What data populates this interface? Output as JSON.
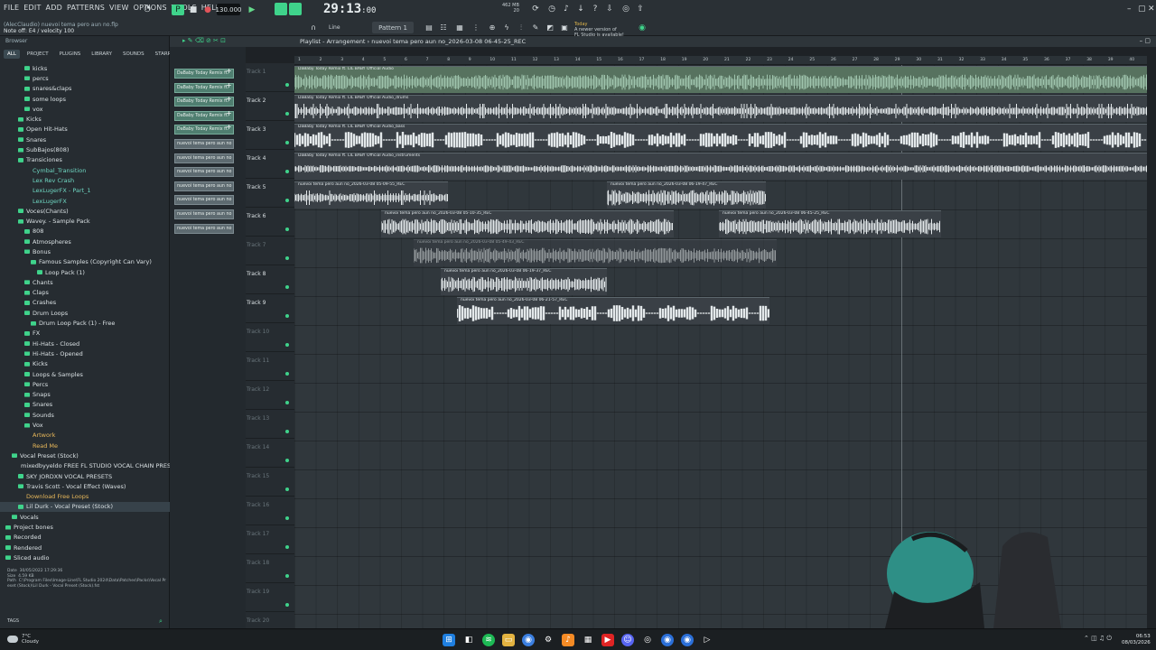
{
  "menu": [
    "FILE",
    "EDIT",
    "ADD",
    "PATTERNS",
    "VIEW",
    "OPTIONS",
    "TOOLS",
    "HELP"
  ],
  "hint": {
    "line1": "(AlecClaudio) nuevoi tema pero aun no.flp",
    "line2": "Note off: E4 / velocity 100"
  },
  "transport": {
    "tempo": "130.000",
    "time_main": "29:13",
    "time_sub": ":00",
    "pattern": "Pattern 1",
    "snap": "Line"
  },
  "cpu_mem": {
    "mem": "462 MB",
    "cpu": "20"
  },
  "news": {
    "day": "Today",
    "msg1": "A newer version of",
    "msg2": "FL Studio is available!"
  },
  "browser": {
    "title": "Browser",
    "tabs": [
      "ALL",
      "PROJECT",
      "PLUGINS",
      "LIBRARY",
      "SOUNDS",
      "STARRED"
    ],
    "active_tab": "ALL",
    "items": [
      {
        "label": "kicks",
        "indent": 3,
        "style": ""
      },
      {
        "label": "percs",
        "indent": 3,
        "style": ""
      },
      {
        "label": "snares&claps",
        "indent": 3,
        "style": ""
      },
      {
        "label": "some loops",
        "indent": 3,
        "style": ""
      },
      {
        "label": "vox",
        "indent": 3,
        "style": ""
      },
      {
        "label": "Kicks",
        "indent": 2,
        "style": ""
      },
      {
        "label": "Open Hit-Hats",
        "indent": 2,
        "style": ""
      },
      {
        "label": "Snares",
        "indent": 2,
        "style": ""
      },
      {
        "label": "SubBajos(808)",
        "indent": 2,
        "style": ""
      },
      {
        "label": "Transiciones",
        "indent": 2,
        "style": ""
      },
      {
        "label": "Cymbal_Transition",
        "indent": 3,
        "style": "teal"
      },
      {
        "label": "Lex Rev Crash",
        "indent": 3,
        "style": "teal"
      },
      {
        "label": "LexLugerFX - Part_1",
        "indent": 3,
        "style": "teal"
      },
      {
        "label": "LexLugerFX",
        "indent": 3,
        "style": "teal"
      },
      {
        "label": "Voces(Chants)",
        "indent": 2,
        "style": ""
      },
      {
        "label": "Wavey. - Sample Pack",
        "indent": 2,
        "style": ""
      },
      {
        "label": "808",
        "indent": 3,
        "style": ""
      },
      {
        "label": "Atmospheres",
        "indent": 3,
        "style": ""
      },
      {
        "label": "Bonus",
        "indent": 3,
        "style": ""
      },
      {
        "label": "Famous Samples (Copyright Can Vary)",
        "indent": 4,
        "style": ""
      },
      {
        "label": "Loop Pack (1)",
        "indent": 5,
        "style": ""
      },
      {
        "label": "Chants",
        "indent": 3,
        "style": ""
      },
      {
        "label": "Claps",
        "indent": 3,
        "style": ""
      },
      {
        "label": "Crashes",
        "indent": 3,
        "style": ""
      },
      {
        "label": "Drum Loops",
        "indent": 3,
        "style": ""
      },
      {
        "label": "Drum Loop Pack (1) - Free",
        "indent": 4,
        "style": ""
      },
      {
        "label": "FX",
        "indent": 3,
        "style": ""
      },
      {
        "label": "Hi-Hats - Closed",
        "indent": 3,
        "style": ""
      },
      {
        "label": "Hi-Hats - Opened",
        "indent": 3,
        "style": ""
      },
      {
        "label": "Kicks",
        "indent": 3,
        "style": ""
      },
      {
        "label": "Loops & Samples",
        "indent": 3,
        "style": ""
      },
      {
        "label": "Percs",
        "indent": 3,
        "style": ""
      },
      {
        "label": "Snaps",
        "indent": 3,
        "style": ""
      },
      {
        "label": "Snares",
        "indent": 3,
        "style": ""
      },
      {
        "label": "Sounds",
        "indent": 3,
        "style": ""
      },
      {
        "label": "Vox",
        "indent": 3,
        "style": ""
      },
      {
        "label": "Artwork",
        "indent": 3,
        "style": "orange"
      },
      {
        "label": "Read Me",
        "indent": 3,
        "style": "orange"
      },
      {
        "label": "Vocal Preset (Stock)",
        "indent": 1,
        "style": ""
      },
      {
        "label": "mixedbyyeldo FREE FL STUDIO VOCAL CHAIN PRESETS VOL. 2",
        "indent": 2,
        "style": ""
      },
      {
        "label": "SKY JORDXN VOCAL PRESETS",
        "indent": 2,
        "style": ""
      },
      {
        "label": "Travis Scott - Vocal Effect (Waves)",
        "indent": 2,
        "style": ""
      },
      {
        "label": "Download Free Loops",
        "indent": 2,
        "style": "orange"
      },
      {
        "label": "Lil Durk - Vocal Preset (Stock)",
        "indent": 2,
        "style": "sel"
      },
      {
        "label": "Vocals",
        "indent": 1,
        "style": ""
      },
      {
        "label": "Project bones",
        "indent": 0,
        "style": ""
      },
      {
        "label": "Recorded",
        "indent": 0,
        "style": ""
      },
      {
        "label": "Rendered",
        "indent": 0,
        "style": ""
      },
      {
        "label": "Sliced audio",
        "indent": 0,
        "style": ""
      }
    ],
    "info": {
      "date_label": "Date",
      "date": "30/05/2022 17:29:36",
      "size_label": "Size",
      "size": "4.59 KB",
      "path_label": "Path",
      "path": "C:\\Program Files\\Image-Line\\FL Studio 2024\\Data\\Patches\\Packs\\Vocal Preset (Stock)\\Lil Durk - Vocal Preset (Stock).fst"
    },
    "tags": "TAGS"
  },
  "playlist": {
    "title": "Playlist - Arrangement",
    "arrangement": "nuevoi tema pero aun no_2026-03-08 06-45-25_REC",
    "patterns": [
      {
        "label": "DaBaby Today Remix ft.",
        "alt": false
      },
      {
        "label": "DaBaby Today Remix ft.",
        "alt": false
      },
      {
        "label": "DaBaby Today Remix ft.",
        "alt": false
      },
      {
        "label": "DaBaby Today Remix ft.",
        "alt": false
      },
      {
        "label": "DaBaby Today Remix ft.",
        "alt": false
      },
      {
        "label": "nuevoi tema pero aun no",
        "alt": true
      },
      {
        "label": "nuevoi tema pero aun no",
        "alt": true
      },
      {
        "label": "nuevoi tema pero aun no",
        "alt": true
      },
      {
        "label": "nuevoi tema pero aun no",
        "alt": true
      },
      {
        "label": "nuevoi tema pero aun no",
        "alt": true
      },
      {
        "label": "nuevoi tema pero aun no",
        "alt": true
      },
      {
        "label": "nuevoi tema pero aun no",
        "alt": true
      }
    ],
    "tracks": [
      "Track 1",
      "Track 2",
      "Track 3",
      "Track 4",
      "Track 5",
      "Track 6",
      "Track 7",
      "Track 8",
      "Track 9",
      "Track 10",
      "Track 11",
      "Track 12",
      "Track 13",
      "Track 14",
      "Track 15",
      "Track 16",
      "Track 17",
      "Track 18",
      "Track 19",
      "Track 20"
    ],
    "ruler": [
      "1",
      "2",
      "3",
      "4",
      "5",
      "6",
      "7",
      "8",
      "9",
      "10",
      "11",
      "12",
      "13",
      "14",
      "15",
      "16",
      "17",
      "18",
      "19",
      "20",
      "21",
      "22",
      "23",
      "24",
      "25",
      "26",
      "27",
      "28",
      "29",
      "30",
      "31",
      "32",
      "33",
      "34",
      "35",
      "36",
      "37",
      "38",
      "39",
      "40"
    ],
    "clips": [
      {
        "track": 0,
        "start": 0,
        "len": 944,
        "title": "DaBaby Today Remix ft. LIL BABY Official Audio",
        "kind": "green",
        "style": "noise"
      },
      {
        "track": 1,
        "start": 0,
        "len": 944,
        "title": "DaBaby Today Remix ft. LIL BABY Official Audio_drums",
        "kind": "",
        "style": "spikes"
      },
      {
        "track": 2,
        "start": 0,
        "len": 944,
        "title": "DaBaby Today Remix ft. LIL BABY Official Audio_bass",
        "kind": "",
        "style": "blobs"
      },
      {
        "track": 3,
        "start": 0,
        "len": 944,
        "title": "DaBaby Today Remix ft. LIL BABY Official Audio_instruments",
        "kind": "",
        "style": "thin"
      },
      {
        "track": 4,
        "start": 0,
        "len": 170,
        "title": "nuevoi tema pero aun no_2026-03-08 05-09-55_REC",
        "kind": "",
        "style": "spikes"
      },
      {
        "track": 4,
        "start": 346,
        "len": 176,
        "title": "nuevoi tema pero aun no_2026-03-08 06-19-47_REC",
        "kind": "",
        "style": "noise"
      },
      {
        "track": 5,
        "start": 96,
        "len": 324,
        "title": "nuevoi tema pero aun no_2026-03-08 05-10-35_REC",
        "kind": "",
        "style": "noise"
      },
      {
        "track": 5,
        "start": 470,
        "len": 246,
        "title": "nuevoi tema pero aun no_2026-03-08 06-45-25_REC",
        "kind": "",
        "style": "noise"
      },
      {
        "track": 6,
        "start": 132,
        "len": 402,
        "title": "nuevoi tema pero aun no_2026-03-08 05-49-43_REC",
        "kind": "dim",
        "style": "noise"
      },
      {
        "track": 7,
        "start": 162,
        "len": 184,
        "title": "nuevoi tema pero aun no_2026-03-08 06-19-37_REC",
        "kind": "",
        "style": "noise"
      },
      {
        "track": 8,
        "start": 180,
        "len": 346,
        "title": "nuevoi tema pero aun no_2026-03-08 06-21-57_REC",
        "kind": "",
        "style": "blobs"
      }
    ]
  },
  "taskbar": {
    "temp": "7°C",
    "weather": "Cloudy",
    "time": "06:53",
    "date": "08/03/2026"
  }
}
